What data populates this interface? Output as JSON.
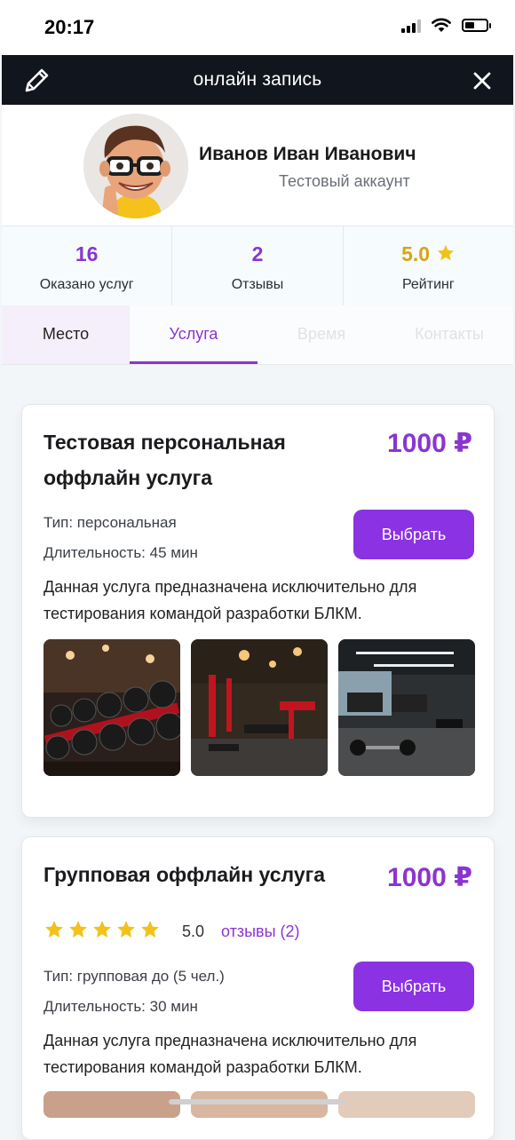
{
  "status_bar": {
    "time": "20:17"
  },
  "header": {
    "title": "онлайн запись",
    "edit_icon": "pencil-icon",
    "close_icon": "close-icon"
  },
  "profile": {
    "name": "Иванов Иван Иванович",
    "subtitle": "Тестовый аккаунт"
  },
  "stats": [
    {
      "value": "16",
      "label": "Оказано услуг"
    },
    {
      "value": "2",
      "label": "Отзывы"
    },
    {
      "value": "5.0",
      "label": "Рейтинг"
    }
  ],
  "tabs": [
    {
      "label": "Место",
      "state": "visited"
    },
    {
      "label": "Услуга",
      "state": "active"
    },
    {
      "label": "Время",
      "state": "disabled"
    },
    {
      "label": "Контакты",
      "state": "disabled"
    }
  ],
  "services": [
    {
      "title": "Тестовая персональная оффлайн услуга",
      "price": "1000 ₽",
      "type": "Тип: персональная",
      "duration": "Длительность: 45 мин",
      "button": "Выбрать",
      "description": "Данная услуга предназначена исключительно для тестирования командой разработки БЛКМ."
    },
    {
      "title": "Групповая оффлайн услуга",
      "price": "1000 ₽",
      "rating": "5.0",
      "stars": 5,
      "reviews": "отзывы (2)",
      "type": "Тип: групповая до (5 чел.)",
      "duration": "Длительность: 30 мин",
      "button": "Выбрать",
      "description": "Данная услуга предназначена исключительно для тестирования командой разработки БЛКМ."
    }
  ],
  "colors": {
    "accent": "#8a35d0",
    "button": "#8b32e3",
    "header_bg": "#11161e",
    "star": "#f2c21a"
  }
}
